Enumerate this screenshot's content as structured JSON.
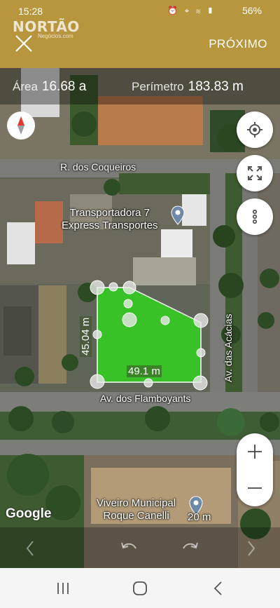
{
  "status": {
    "time": "15:28",
    "icons": "⏰ ⌖ ≋ ▮",
    "battery": "56%"
  },
  "header": {
    "logo_text": "NORTÃO",
    "logo_sub": "Negócios.com",
    "next_label": "PRÓXIMO"
  },
  "metrics": {
    "area_label": "Área",
    "area_value": "16.68 a",
    "perimeter_label": "Perímetro",
    "perimeter_value": "183.83 m"
  },
  "map": {
    "streets": {
      "coqueiros": "R. dos Coqueiros",
      "flamboyants": "Av. dos Flamboyants",
      "acacias": "Av. das Acácias"
    },
    "pois": {
      "transportadora_line1": "Transportadora 7",
      "transportadora_line2": "Express Transportes",
      "viveiro_line1": "Viveiro Municipal",
      "viveiro_line2": "Roque Canelli"
    },
    "measurements": {
      "side_left": "45.04 m",
      "side_bottom": "49.1 m"
    },
    "scale": "20 m",
    "attribution": "Google"
  },
  "colors": {
    "header": "#b8963d",
    "polygon": "#32d21e",
    "map_dark": "#3f4a3a"
  },
  "icons": {
    "close": "close-icon",
    "compass": "compass-icon",
    "locate": "my-location-icon",
    "fullscreen": "fullscreen-icon",
    "more": "more-vertical-icon",
    "zoom_in": "plus-icon",
    "zoom_out": "minus-icon",
    "undo": "undo-icon",
    "redo": "redo-icon"
  }
}
